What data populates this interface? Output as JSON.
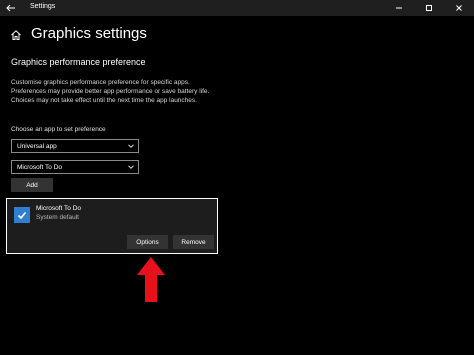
{
  "window": {
    "title": "Settings",
    "controls": {
      "minimize": "—",
      "maximize": "☐",
      "close": "✕"
    }
  },
  "page": {
    "title": "Graphics settings"
  },
  "section": {
    "heading": "Graphics performance preference",
    "description": "Customise graphics performance preference for specific apps. Preferences may provide better app performance or save battery life. Choices may not take effect until the next time the app launches."
  },
  "chooser": {
    "label": "Choose an app to set preference",
    "app_type_selected": "Universal app",
    "app_selected": "Microsoft To Do",
    "add_label": "Add"
  },
  "app_list": [
    {
      "name": "Microsoft To Do",
      "preference": "System default",
      "options_label": "Options",
      "remove_label": "Remove"
    }
  ],
  "colors": {
    "background": "#000000",
    "accent": "#2f7fd1",
    "annotation_arrow": "#e8101a"
  }
}
